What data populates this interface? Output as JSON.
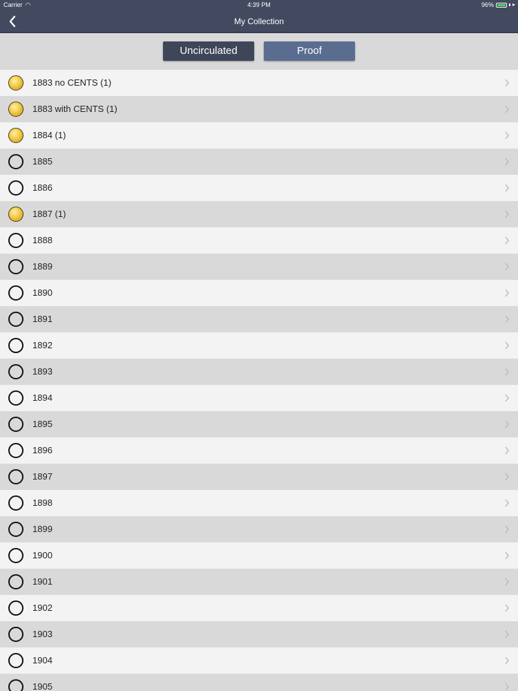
{
  "status": {
    "carrier": "Carrier",
    "time": "4:39 PM",
    "battery": "96%",
    "battery_level": 0.96,
    "battery_color": "#4cd964"
  },
  "nav": {
    "title": "My Collection",
    "back_icon": "chevron-left-icon"
  },
  "segments": [
    {
      "label": "Uncirculated",
      "selected": true
    },
    {
      "label": "Proof",
      "selected": false
    }
  ],
  "colors": {
    "nav_bg": "#434a60",
    "segment_selected": "#3f4659",
    "segment_unselected": "#5a6d91",
    "row_light": "#f3f3f3",
    "row_dark": "#d9d9d9",
    "coin_gold": "#f2c94a"
  },
  "items": [
    {
      "label": "1883 no CENTS (1)",
      "owned": true
    },
    {
      "label": "1883 with CENTS (1)",
      "owned": true
    },
    {
      "label": "1884 (1)",
      "owned": true
    },
    {
      "label": "1885",
      "owned": false
    },
    {
      "label": "1886",
      "owned": false
    },
    {
      "label": "1887 (1)",
      "owned": true
    },
    {
      "label": "1888",
      "owned": false
    },
    {
      "label": "1889",
      "owned": false
    },
    {
      "label": "1890",
      "owned": false
    },
    {
      "label": "1891",
      "owned": false
    },
    {
      "label": "1892",
      "owned": false
    },
    {
      "label": "1893",
      "owned": false
    },
    {
      "label": "1894",
      "owned": false
    },
    {
      "label": "1895",
      "owned": false
    },
    {
      "label": "1896",
      "owned": false
    },
    {
      "label": "1897",
      "owned": false
    },
    {
      "label": "1898",
      "owned": false
    },
    {
      "label": "1899",
      "owned": false
    },
    {
      "label": "1900",
      "owned": false
    },
    {
      "label": "1901",
      "owned": false
    },
    {
      "label": "1902",
      "owned": false
    },
    {
      "label": "1903",
      "owned": false
    },
    {
      "label": "1904",
      "owned": false
    },
    {
      "label": "1905",
      "owned": false
    }
  ]
}
